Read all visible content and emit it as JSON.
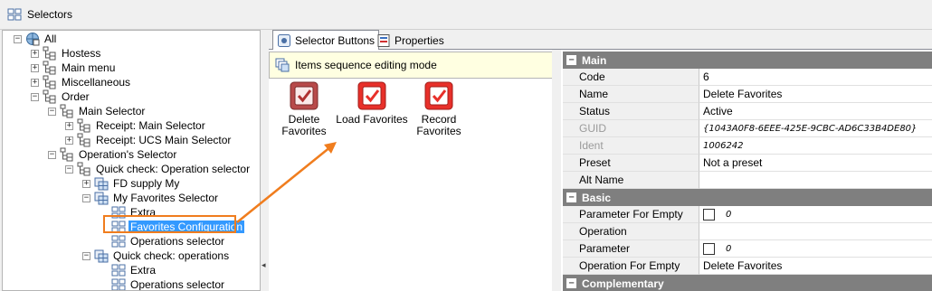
{
  "window": {
    "title": "Selectors"
  },
  "tree": {
    "items": [
      {
        "label": "All",
        "level": 0,
        "expander": "-",
        "icon": "globe-icon"
      },
      {
        "label": "Hostess",
        "level": 1,
        "expander": "+",
        "icon": "folder-tree-icon"
      },
      {
        "label": "Main menu",
        "level": 1,
        "expander": "+",
        "icon": "folder-tree-icon"
      },
      {
        "label": "Miscellaneous",
        "level": 1,
        "expander": "+",
        "icon": "folder-tree-icon"
      },
      {
        "label": "Order",
        "level": 1,
        "expander": "-",
        "icon": "folder-tree-icon"
      },
      {
        "label": "Main Selector",
        "level": 2,
        "expander": "-",
        "icon": "folder-tree-icon"
      },
      {
        "label": "Receipt: Main Selector",
        "level": 3,
        "expander": "+",
        "icon": "folder-tree-icon"
      },
      {
        "label": "Receipt: UCS Main Selector",
        "level": 3,
        "expander": "+",
        "icon": "folder-tree-icon"
      },
      {
        "label": "Operation's Selector",
        "level": 2,
        "expander": "-",
        "icon": "folder-tree-icon"
      },
      {
        "label": "Quick check: Operation selector",
        "level": 3,
        "expander": "-",
        "icon": "folder-tree-icon"
      },
      {
        "label": "FD supply My",
        "level": 4,
        "expander": "+",
        "icon": "folder-grid-icon"
      },
      {
        "label": "My Favorites Selector",
        "level": 4,
        "expander": "-",
        "icon": "folder-grid-icon"
      },
      {
        "label": "Extra",
        "level": 5,
        "expander": "",
        "icon": "grid-icon"
      },
      {
        "label": "Favorites Configuration",
        "level": 5,
        "expander": "",
        "icon": "grid-icon",
        "selected": true
      },
      {
        "label": "Operations selector",
        "level": 5,
        "expander": "",
        "icon": "grid-icon"
      },
      {
        "label": "Quick check: operations",
        "level": 4,
        "expander": "-",
        "icon": "folder-grid-icon"
      },
      {
        "label": "Extra",
        "level": 5,
        "expander": "",
        "icon": "grid-icon"
      },
      {
        "label": "Operations selector",
        "level": 5,
        "expander": "",
        "icon": "grid-icon"
      }
    ]
  },
  "tabs": [
    {
      "label": "Selector Buttons",
      "icon": "selector-buttons-icon",
      "active": true
    },
    {
      "label": "Properties",
      "icon": "properties-icon",
      "active": false
    }
  ],
  "modebar": {
    "label": "Items sequence editing mode"
  },
  "selector_buttons": [
    {
      "line1": "Delete",
      "line2": "Favorites",
      "style": "dark"
    },
    {
      "line1": "Load Favorites",
      "line2": "",
      "style": "bright"
    },
    {
      "line1": "Record",
      "line2": "Favorites",
      "style": "bright"
    }
  ],
  "properties": {
    "main": {
      "title": "Main",
      "rows": [
        {
          "name": "Code",
          "value": "6"
        },
        {
          "name": "Name",
          "value": "Delete Favorites"
        },
        {
          "name": "Status",
          "value": "Active"
        },
        {
          "name": "GUID",
          "value": "{1043A0F8-6EEE-425E-9CBC-AD6C33B4DE80}",
          "dim": true,
          "italic": true
        },
        {
          "name": "Ident",
          "value": "1006242",
          "dim": true,
          "italic": true
        },
        {
          "name": "Preset",
          "value": "Not a preset"
        },
        {
          "name": "Alt Name",
          "value": ""
        }
      ]
    },
    "basic": {
      "title": "Basic",
      "rows": [
        {
          "name": "Parameter For Empty",
          "value": "0",
          "checkbox": true
        },
        {
          "name": "Operation",
          "value": ""
        },
        {
          "name": "Parameter",
          "value": "0",
          "checkbox": true
        },
        {
          "name": "Operation For Empty",
          "value": "Delete Favorites"
        }
      ]
    },
    "complementary": {
      "title": "Complementary"
    }
  },
  "colors": {
    "accent": "#f07d1e",
    "selection": "#3399ff",
    "category": "#7f7f7f",
    "button_red": "#e8302a",
    "button_dark": "#b84a4a"
  }
}
